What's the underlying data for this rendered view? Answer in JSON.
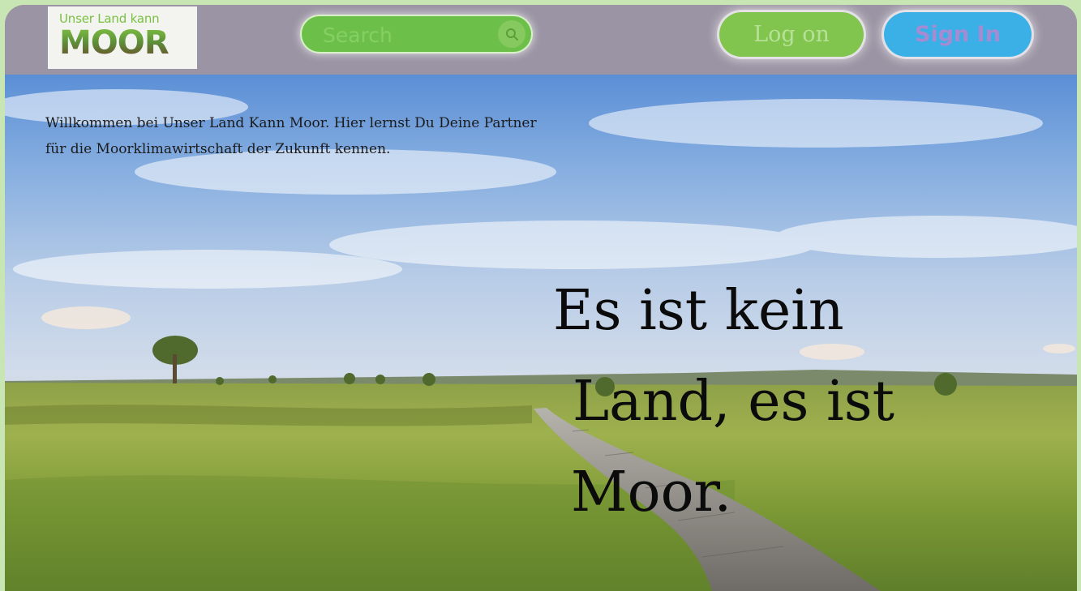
{
  "header": {
    "logo": {
      "line1": "Unser Land kann",
      "line2": "MOOR"
    },
    "search": {
      "placeholder": "Search",
      "icon": "search-icon"
    },
    "login_label": "Log on",
    "signin_label": "Sign In"
  },
  "hero": {
    "welcome_line1": "Willkommen bei Unser Land Kann Moor. Hier lernst Du Deine Partner",
    "welcome_line2": "für die Moorklimawirtschaft der Zukunft kennen.",
    "tagline_line1": "Es ist kein",
    "tagline_line2": "Land, es ist",
    "tagline_line3": "Moor."
  },
  "colors": {
    "header_bg": "#9b94a4",
    "search_bg": "#6cc04a",
    "login_bg": "#82c54e",
    "signin_bg": "#3ab0e6",
    "signin_text": "#a58bd2",
    "page_bg": "#c8e6b4"
  }
}
